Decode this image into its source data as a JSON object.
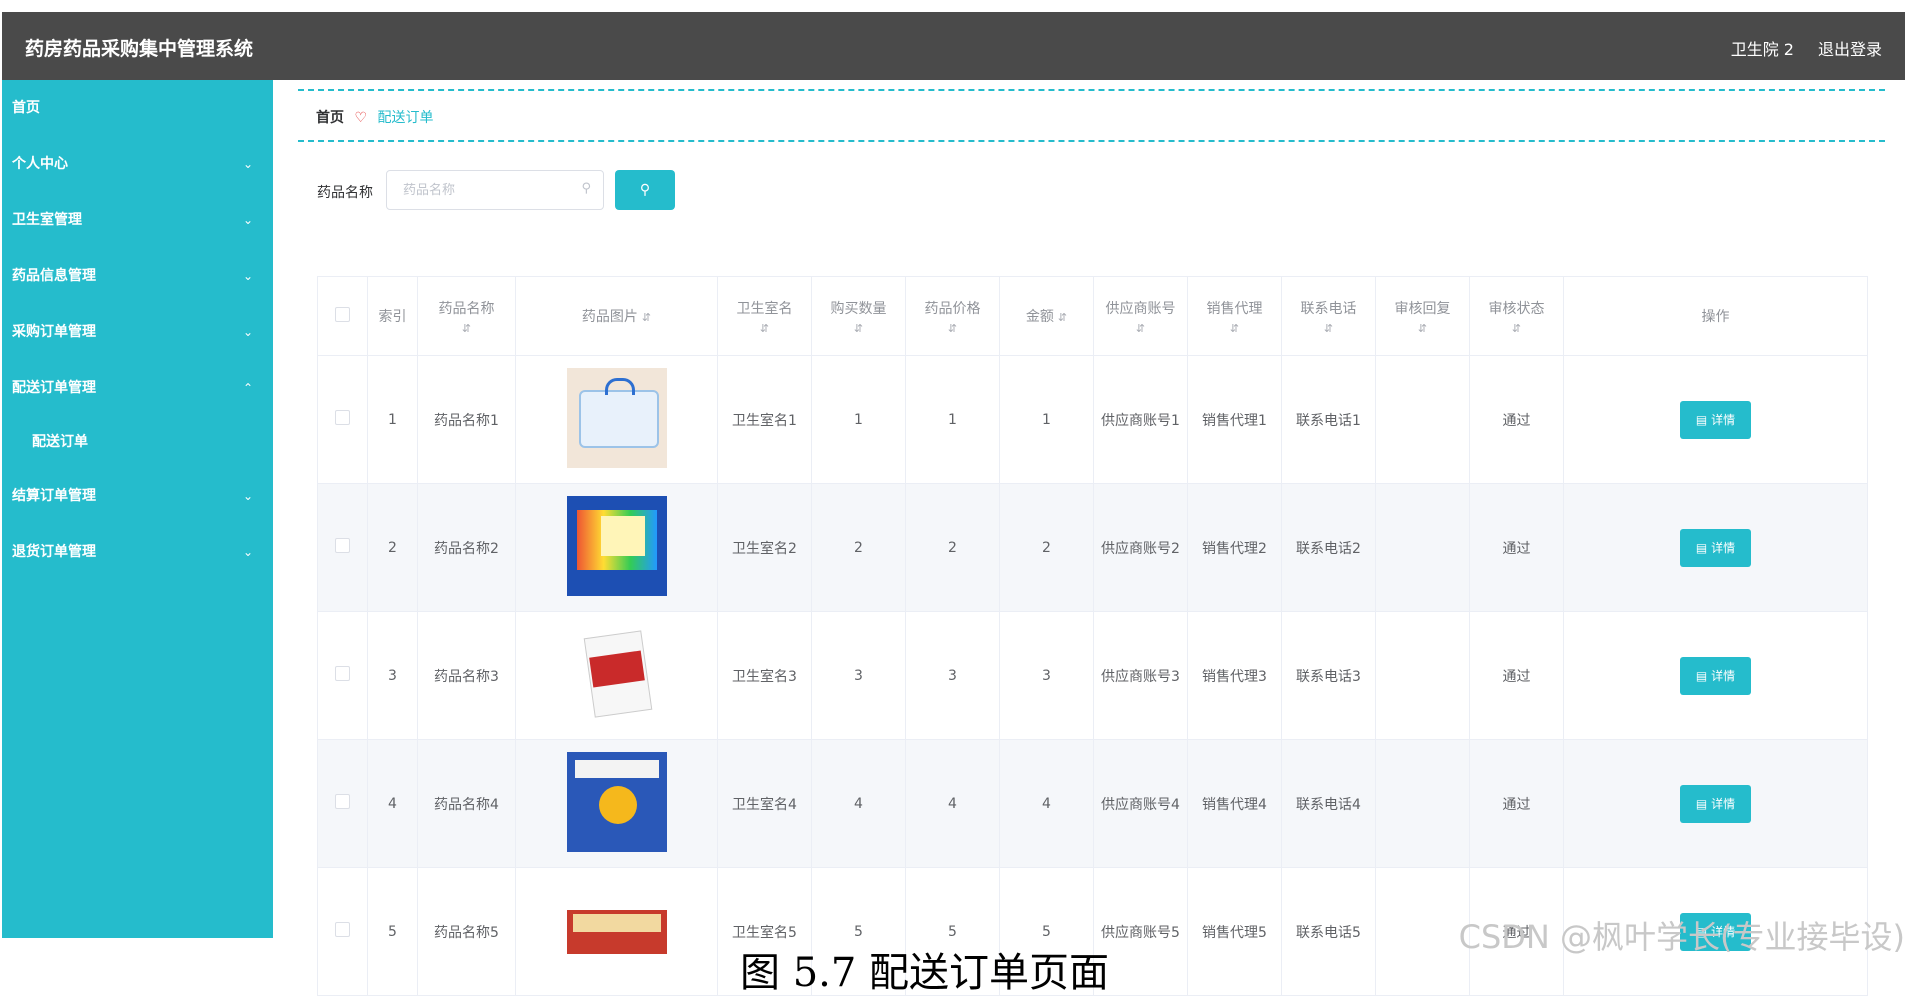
{
  "header": {
    "title": "药房药品采购集中管理系统",
    "user": "卫生院 2",
    "logout": "退出登录"
  },
  "sidebar": {
    "items": [
      {
        "label": "首页",
        "icon": ""
      },
      {
        "label": "个人中心",
        "icon": "chevron-down"
      },
      {
        "label": "卫生室管理",
        "icon": "chevron-down"
      },
      {
        "label": "药品信息管理",
        "icon": "chevron-down"
      },
      {
        "label": "采购订单管理",
        "icon": "chevron-down"
      },
      {
        "label": "配送订单管理",
        "icon": "chevron-up"
      },
      {
        "label": "结算订单管理",
        "icon": "chevron-down"
      },
      {
        "label": "退货订单管理",
        "icon": "chevron-down"
      }
    ],
    "sub": {
      "label": "配送订单"
    }
  },
  "breadcrumb": {
    "home": "首页",
    "separator": "♡",
    "current": "配送订单"
  },
  "search": {
    "label": "药品名称",
    "placeholder": "药品名称"
  },
  "table": {
    "headers": [
      "索引",
      "药品名称",
      "药品图片",
      "卫生室名",
      "购买数量",
      "药品价格",
      "金额",
      "供应商账号",
      "销售代理",
      "联系电话",
      "审核回复",
      "审核状态",
      "操作"
    ],
    "detail_label": "详情",
    "rows": [
      {
        "index": "1",
        "name": "药品名称1",
        "clinic": "卫生室名1",
        "qty": "1",
        "price": "1",
        "amount": "1",
        "supplier": "供应商账号1",
        "agent": "销售代理1",
        "phone": "联系电话1",
        "reply": "",
        "status": "通过"
      },
      {
        "index": "2",
        "name": "药品名称2",
        "clinic": "卫生室名2",
        "qty": "2",
        "price": "2",
        "amount": "2",
        "supplier": "供应商账号2",
        "agent": "销售代理2",
        "phone": "联系电话2",
        "reply": "",
        "status": "通过"
      },
      {
        "index": "3",
        "name": "药品名称3",
        "clinic": "卫生室名3",
        "qty": "3",
        "price": "3",
        "amount": "3",
        "supplier": "供应商账号3",
        "agent": "销售代理3",
        "phone": "联系电话3",
        "reply": "",
        "status": "通过"
      },
      {
        "index": "4",
        "name": "药品名称4",
        "clinic": "卫生室名4",
        "qty": "4",
        "price": "4",
        "amount": "4",
        "supplier": "供应商账号4",
        "agent": "销售代理4",
        "phone": "联系电话4",
        "reply": "",
        "status": "通过"
      },
      {
        "index": "5",
        "name": "药品名称5",
        "clinic": "卫生室名5",
        "qty": "5",
        "price": "5",
        "amount": "5",
        "supplier": "供应商账号5",
        "agent": "销售代理5",
        "phone": "联系电话5",
        "reply": "",
        "status": "通过"
      }
    ]
  },
  "footer": {
    "caption": "图 5.7 配送订单页面",
    "watermark": "CSDN @枫叶学长(专业接毕设)"
  },
  "colors": {
    "accent": "#25bccc",
    "header_bg": "#4a4a4a",
    "breadcrumb_sep": "#e02424"
  }
}
